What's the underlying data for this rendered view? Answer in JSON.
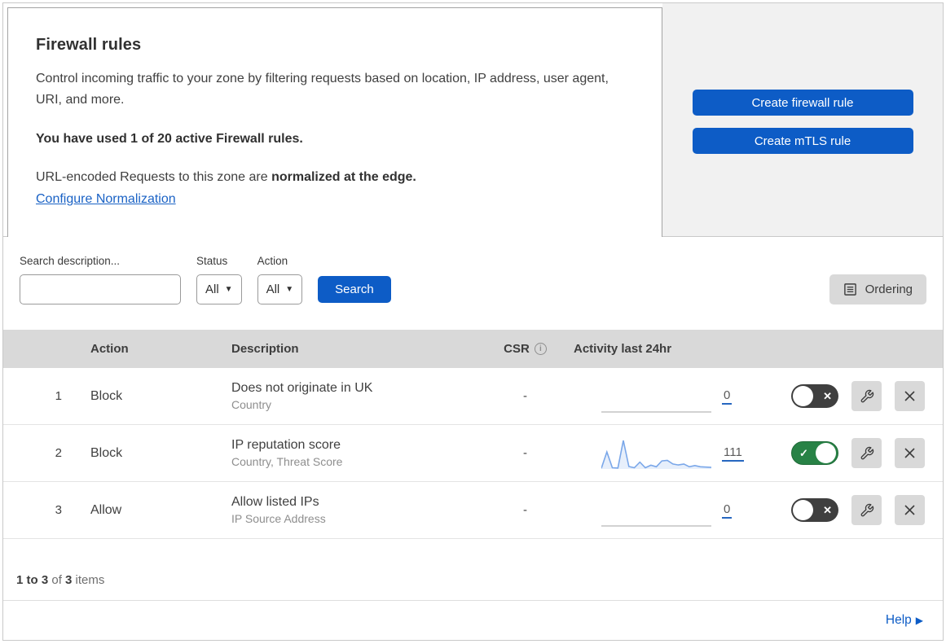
{
  "header_card": {
    "title": "Firewall rules",
    "description": "Control incoming traffic to your zone by filtering requests based on location, IP address, user agent, URI, and more.",
    "usage_notice": "You have used 1 of 20 active Firewall rules.",
    "normalization_prefix": "URL-encoded Requests to this zone are ",
    "normalization_bold": "normalized at the edge.",
    "normalization_link": "Configure Normalization"
  },
  "actions_panel": {
    "create_firewall_label": "Create firewall rule",
    "create_mtls_label": "Create mTLS rule"
  },
  "filters": {
    "search_label": "Search description...",
    "search_value": "",
    "status_label": "Status",
    "status_value": "All",
    "action_label": "Action",
    "action_value": "All",
    "search_button_label": "Search",
    "ordering_button_label": "Ordering"
  },
  "table": {
    "columns": {
      "action": "Action",
      "description": "Description",
      "csr": "CSR",
      "activity": "Activity last 24hr"
    },
    "rows": [
      {
        "priority": "1",
        "action": "Block",
        "description": "Does not originate in UK",
        "criteria": "Country",
        "csr": "-",
        "activity_count": "0",
        "enabled": false,
        "sparkline": []
      },
      {
        "priority": "2",
        "action": "Block",
        "description": "IP reputation score",
        "criteria": "Country, Threat Score",
        "csr": "-",
        "activity_count": "111",
        "enabled": true,
        "sparkline": [
          2,
          55,
          4,
          3,
          92,
          8,
          4,
          22,
          4,
          12,
          7,
          26,
          28,
          16,
          13,
          16,
          7,
          11,
          7,
          6,
          5
        ]
      },
      {
        "priority": "3",
        "action": "Allow",
        "description": "Allow listed IPs",
        "criteria": "IP Source Address",
        "csr": "-",
        "activity_count": "0",
        "enabled": false,
        "sparkline": []
      }
    ],
    "footer": {
      "range_bold": "1 to 3",
      "of_text": " of ",
      "total_bold": "3",
      "items_text": " items"
    }
  },
  "help": {
    "label": "Help"
  },
  "colors": {
    "accent_blue": "#0d5cc6",
    "toggle_on_green": "#288246",
    "toggle_off_gray": "#3f3f3f",
    "sparkline_blue": "#7aa7e9",
    "header_gray": "#d9d9d9"
  }
}
